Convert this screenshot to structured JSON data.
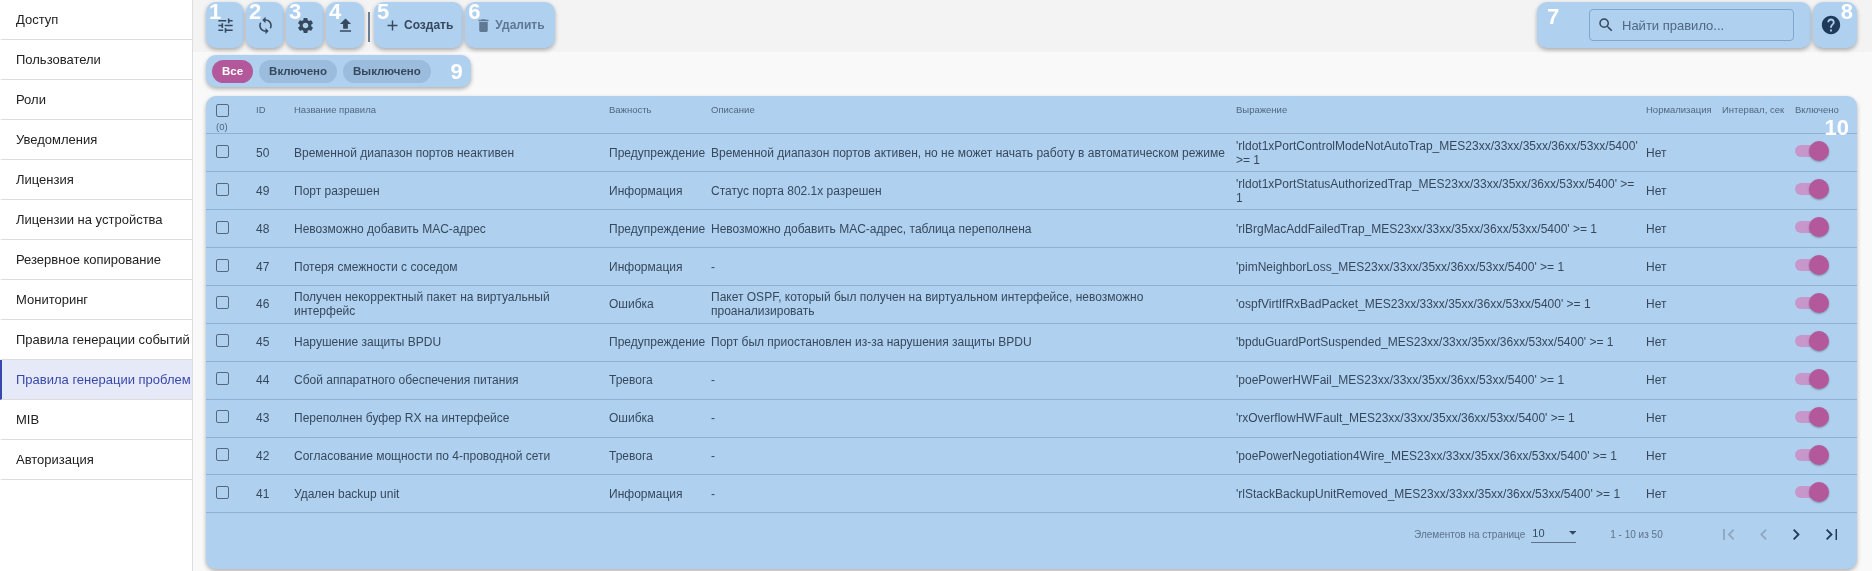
{
  "sidebar": {
    "items": [
      {
        "label": "Доступ",
        "selected": false
      },
      {
        "label": "Пользователи",
        "selected": false
      },
      {
        "label": "Роли",
        "selected": false
      },
      {
        "label": "Уведомления",
        "selected": false
      },
      {
        "label": "Лицензия",
        "selected": false
      },
      {
        "label": "Лицензии на устройства",
        "selected": false
      },
      {
        "label": "Резервное копирование",
        "selected": false
      },
      {
        "label": "Мониторинг",
        "selected": false
      },
      {
        "label": "Правила генерации событий",
        "selected": false
      },
      {
        "label": "Правила генерации проблем",
        "selected": true
      },
      {
        "label": "MIB",
        "selected": false
      },
      {
        "label": "Авторизация",
        "selected": false
      }
    ]
  },
  "toolbar": {
    "buttons": [
      {
        "kind": "icon",
        "callout": "1",
        "disabled": false
      },
      {
        "kind": "icon",
        "callout": "2",
        "disabled": false
      },
      {
        "kind": "icon",
        "callout": "3",
        "disabled": false
      },
      {
        "kind": "icon",
        "callout": "4",
        "disabled": false
      },
      {
        "kind": "text",
        "callout": "5",
        "label": "Создать",
        "disabled": false
      },
      {
        "kind": "text",
        "callout": "6",
        "label": "Удалить",
        "disabled": true
      }
    ]
  },
  "search": {
    "callout": "7",
    "placeholder": "Найти правило..."
  },
  "help": {
    "callout": "8"
  },
  "filters": {
    "callout": "9",
    "chips": [
      {
        "label": "Все",
        "selected": true
      },
      {
        "label": "Включено",
        "selected": false
      },
      {
        "label": "Выключено",
        "selected": false
      }
    ]
  },
  "table": {
    "callout": "10",
    "checked": false,
    "count": "(0)",
    "columns": [
      "ID",
      "Название правила",
      "Важность",
      "Описание",
      "Выражение",
      "Нормализация",
      "Интервал, сек",
      "Включено"
    ],
    "rows": [
      {
        "checked": false,
        "id": "50",
        "name": "Временной диапазон портов неактивен",
        "severity": "Предупреждение",
        "description": "Временной диапазон портов активен, но не может начать работу в автоматическом режиме",
        "expression": "'rldot1xPortControlModeNotAutoTrap_MES23xx/33xx/35xx/36xx/53xx/5400' >= 1",
        "normalization": "Нет",
        "enabled": true
      },
      {
        "checked": false,
        "id": "49",
        "name": "Порт разрешен",
        "severity": "Информация",
        "description": "Статус порта 802.1x разрешен",
        "expression": "'rldot1xPortStatusAuthorizedTrap_MES23xx/33xx/35xx/36xx/53xx/5400' >= 1",
        "normalization": "Нет",
        "enabled": true
      },
      {
        "checked": false,
        "id": "48",
        "name": "Невозможно добавить MAC-адрес",
        "severity": "Предупреждение",
        "description": "Невозможно добавить MAC-адрес, таблица переполнена",
        "expression": "'rlBrgMacAddFailedTrap_MES23xx/33xx/35xx/36xx/53xx/5400' >= 1",
        "normalization": "Нет",
        "enabled": true
      },
      {
        "checked": false,
        "id": "47",
        "name": "Потеря смежности с соседом",
        "severity": "Информация",
        "description": "-",
        "expression": "'pimNeighborLoss_MES23xx/33xx/35xx/36xx/53xx/5400' >= 1",
        "normalization": "Нет",
        "enabled": true
      },
      {
        "checked": false,
        "id": "46",
        "name": "Получен некорректный пакет на виртуальный интерфейс",
        "severity": "Ошибка",
        "description": "Пакет OSPF, который был получен на виртуальном интерфейсе, невозможно проанализировать",
        "expression": "'ospfVirtIfRxBadPacket_MES23xx/33xx/35xx/36xx/53xx/5400' >= 1",
        "normalization": "Нет",
        "enabled": true
      },
      {
        "checked": false,
        "id": "45",
        "name": "Нарушение защиты BPDU",
        "severity": "Предупреждение",
        "description": "Порт был приостановлен из-за нарушения защиты BPDU",
        "expression": "'bpduGuardPortSuspended_MES23xx/33xx/35xx/36xx/53xx/5400' >= 1",
        "normalization": "Нет",
        "enabled": true
      },
      {
        "checked": false,
        "id": "44",
        "name": "Сбой аппаратного обеспечения питания",
        "severity": "Тревога",
        "description": "-",
        "expression": "'poePowerHWFail_MES23xx/33xx/35xx/36xx/53xx/5400' >= 1",
        "normalization": "Нет",
        "enabled": true
      },
      {
        "checked": false,
        "id": "43",
        "name": "Переполнен буфер RX на интерфейсе",
        "severity": "Ошибка",
        "description": "-",
        "expression": "'rxOverflowHWFault_MES23xx/33xx/35xx/36xx/53xx/5400' >= 1",
        "normalization": "Нет",
        "enabled": true
      },
      {
        "checked": false,
        "id": "42",
        "name": "Согласование мощности по 4-проводной сети",
        "severity": "Тревога",
        "description": "-",
        "expression": "'poePowerNegotiation4Wire_MES23xx/33xx/35xx/36xx/53xx/5400' >= 1",
        "normalization": "Нет",
        "enabled": true
      },
      {
        "checked": false,
        "id": "41",
        "name": "Удален backup unit",
        "severity": "Информация",
        "description": "-",
        "expression": "'rlStackBackupUnitRemoved_MES23xx/33xx/35xx/36xx/53xx/5400' >= 1",
        "normalization": "Нет",
        "enabled": true
      }
    ]
  },
  "pagination": {
    "label": "Элементов на странице",
    "page_size": "10",
    "range": "1 - 10 из 50",
    "nav": [
      {
        "disabled": true
      },
      {
        "disabled": true
      },
      {
        "disabled": false
      },
      {
        "disabled": false
      }
    ]
  }
}
